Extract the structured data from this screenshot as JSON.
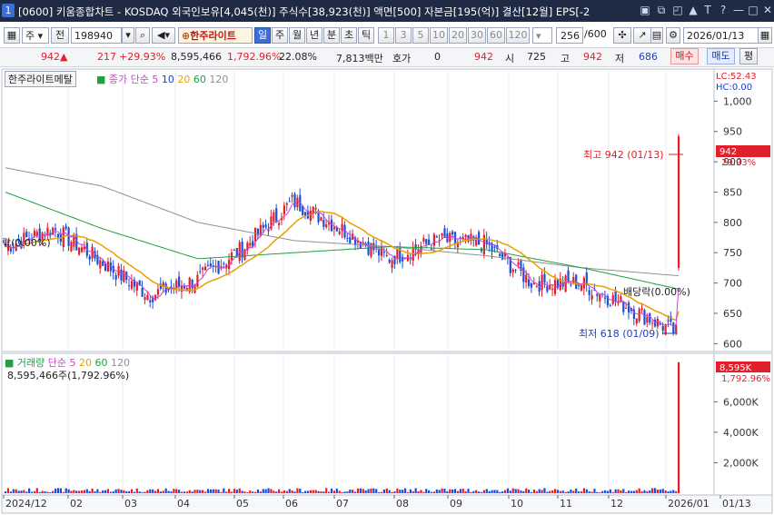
{
  "window": {
    "number": "1",
    "title": "[0600] 키움종합차트 - KOSDAQ 외국인보유[4,045(천)] 주식수[38,923(천)] 액면[500] 자본금[195(억)] 결산[12월] EPS[-2"
  },
  "toolbar": {
    "period_type": "주",
    "prev_label": "전",
    "code": "198940",
    "stock_name": "한주라이트",
    "intervals": [
      "일",
      "주",
      "월",
      "년",
      "분",
      "초",
      "틱"
    ],
    "selected_interval": "일",
    "minute_options": [
      "1",
      "3",
      "5",
      "10",
      "20",
      "30",
      "60",
      "120"
    ],
    "count": "256",
    "count_total": "/600",
    "date": "2026/01/13"
  },
  "quote": {
    "price": "942",
    "change": "217",
    "change_rate": "+29.93%",
    "volume": "8,595,466",
    "volume_rate": "1,792.96%",
    "turnover": "22.08%",
    "amount": "7,813백만",
    "ask_label": "호가",
    "ask_value": "0",
    "bid_price": "942",
    "open_label": "시",
    "open": "725",
    "high_label": "고",
    "high": "942",
    "low_label": "저",
    "low": "686",
    "buy_label": "매수",
    "sell_label": "매도",
    "eval_label": "평"
  },
  "price_pane": {
    "stock_label": "한주라이트메탈",
    "ma_title": "종가 단순",
    "ma_periods": [
      "5",
      "10",
      "20",
      "60",
      "120"
    ],
    "ma_colors": [
      "#d040d0",
      "#2040c0",
      "#e8a000",
      "#20a040",
      "#909090"
    ],
    "lc": "LC:52.43",
    "hc": "HC:0.00",
    "current_tag": "942",
    "current_rate": "29.93%",
    "high_annotation": "최고 942 (01/13)",
    "low_annotation": "최저 618 (01/09)",
    "dividend_annotation": "배당락(0.00%)",
    "left_label": "락(0.00%)"
  },
  "volume_pane": {
    "title": "거래량",
    "ma_title": "단순",
    "ma_periods": [
      "5",
      "20",
      "60",
      "120"
    ],
    "value_text": "8,595,466주(1,792.96%)",
    "current_tag": "8,595K",
    "current_rate": "1,792.96%"
  },
  "chart_data": {
    "type": "line",
    "title": "",
    "y_ticks": [
      600,
      650,
      700,
      750,
      800,
      850,
      900,
      950,
      1000
    ],
    "y_tick_labels": [
      "600",
      "650",
      "700",
      "750",
      "800",
      "850",
      "900",
      "950",
      "1,000"
    ],
    "ylim": [
      590,
      1050
    ],
    "x_labels": [
      "2024/12",
      "02",
      "03",
      "04",
      "05",
      "06",
      "07",
      "08",
      "09",
      "10",
      "11",
      "12",
      "2026/01",
      "01/13"
    ],
    "close_series": [
      {
        "x": "2024/12",
        "y": 760
      },
      {
        "x": "2025/01",
        "y": 790
      },
      {
        "x": "2025/02",
        "y": 735
      },
      {
        "x": "2025/03",
        "y": 680
      },
      {
        "x": "2025/04",
        "y": 705
      },
      {
        "x": "2025/05",
        "y": 760
      },
      {
        "x": "2025/05b",
        "y": 835
      },
      {
        "x": "2025/06",
        "y": 790
      },
      {
        "x": "2025/07",
        "y": 740
      },
      {
        "x": "2025/08",
        "y": 770
      },
      {
        "x": "2025/09",
        "y": 765
      },
      {
        "x": "2025/10",
        "y": 700
      },
      {
        "x": "2025/11",
        "y": 700
      },
      {
        "x": "2025/12",
        "y": 660
      },
      {
        "x": "2026/01/09",
        "y": 618
      },
      {
        "x": "2026/01/13",
        "y": 942
      }
    ],
    "ma120": [
      {
        "x": "2024/12",
        "y": 890
      },
      {
        "x": "2025/02",
        "y": 860
      },
      {
        "x": "2025/04",
        "y": 800
      },
      {
        "x": "2025/06",
        "y": 770
      },
      {
        "x": "2025/08",
        "y": 760
      },
      {
        "x": "2025/10",
        "y": 745
      },
      {
        "x": "2025/12",
        "y": 725
      },
      {
        "x": "2026/01/13",
        "y": 712
      }
    ],
    "ma60": [
      {
        "x": "2024/12",
        "y": 850
      },
      {
        "x": "2025/02",
        "y": 790
      },
      {
        "x": "2025/03",
        "y": 740
      },
      {
        "x": "2025/05",
        "y": 750
      },
      {
        "x": "2025/07",
        "y": 760
      },
      {
        "x": "2025/09",
        "y": 755
      },
      {
        "x": "2025/11",
        "y": 725
      },
      {
        "x": "2026/01/13",
        "y": 690
      }
    ],
    "volume": {
      "y_ticks": [
        2000,
        4000,
        6000
      ],
      "y_tick_labels": [
        "2,000K",
        "4,000K",
        "6,000K"
      ],
      "ylim": [
        0,
        9000
      ],
      "last_value_k": 8595
    }
  }
}
